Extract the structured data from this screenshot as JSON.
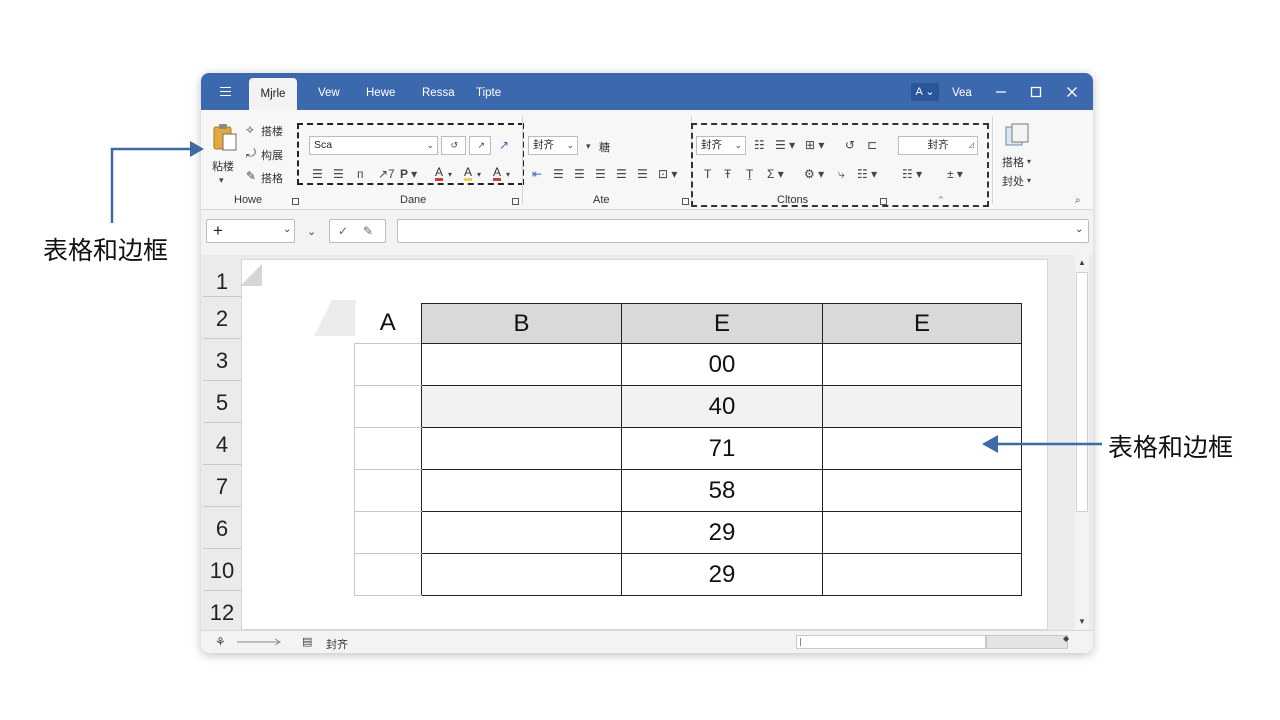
{
  "window": {
    "menu_tabs": [
      "Mjrle",
      "Vew",
      "Hewe",
      "Ressa",
      "Tipte"
    ],
    "active_tab": "Mjrle",
    "account_label": "A ⌄",
    "user_label": "Vea"
  },
  "ribbon": {
    "clipboard": {
      "paste_label": "粘楼",
      "items": [
        "搭楼",
        "构展",
        "搭格"
      ],
      "group_label": "Howe"
    },
    "font": {
      "font_name": "Sca",
      "group_label": "Dane"
    },
    "alignment": {
      "style_value": "封齐",
      "extra_label": "糖",
      "group_label": "Ate"
    },
    "options": {
      "style_value": "封齐",
      "box_value": "封齐",
      "group_label": "Cltons"
    },
    "cells": {
      "items": [
        "搭格",
        "封处"
      ]
    }
  },
  "formula_bar": {
    "name_box": "+",
    "formula": ""
  },
  "sheet": {
    "row_headers": [
      "1",
      "2",
      "3",
      "5",
      "4",
      "7",
      "6",
      "10",
      "12"
    ],
    "table_header": [
      "A",
      "B",
      "E",
      "E"
    ],
    "table_rows": [
      [
        "",
        "",
        "00",
        ""
      ],
      [
        "",
        "",
        "40",
        ""
      ],
      [
        "",
        "",
        "71",
        ""
      ],
      [
        "",
        "",
        "58",
        ""
      ],
      [
        "",
        "",
        "29",
        ""
      ],
      [
        "",
        "",
        "29",
        ""
      ]
    ]
  },
  "status_bar": {
    "text": "封齐"
  },
  "annotations": {
    "left_label": "表格和边框",
    "right_label": "表格和边框"
  },
  "colors": {
    "title_bar": "#3c68ad",
    "arrow": "#3f6aa6"
  }
}
